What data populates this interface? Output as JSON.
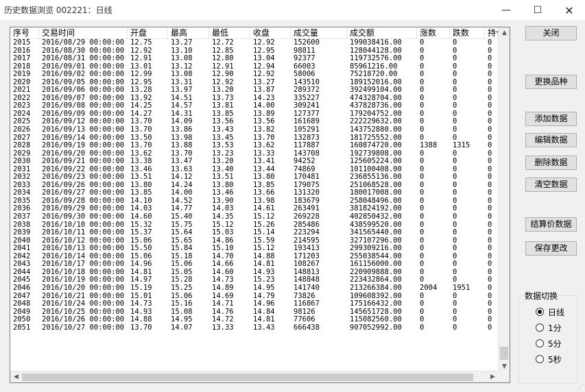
{
  "window": {
    "title": "历史数据浏览 002221：日线"
  },
  "columns": [
    "序号",
    "交易时间",
    "开盘",
    "最高",
    "最低",
    "收盘",
    "成交量",
    "成交额",
    "涨数",
    "跌数",
    "持仓"
  ],
  "rows": [
    [
      "2015",
      "2016/08/29 00:00:00",
      "12.75",
      "13.27",
      "12.72",
      "12.92",
      "152600",
      "199038416.00",
      "0",
      "0",
      "0"
    ],
    [
      "2016",
      "2016/08/30 00:00:00",
      "12.92",
      "13.10",
      "12.85",
      "12.95",
      "98811",
      "128044128.00",
      "0",
      "0",
      "0"
    ],
    [
      "2017",
      "2016/08/31 00:00:00",
      "12.91",
      "13.08",
      "12.80",
      "13.04",
      "92377",
      "119732576.00",
      "0",
      "0",
      "0"
    ],
    [
      "2018",
      "2016/09/01 00:00:00",
      "13.01",
      "13.12",
      "12.91",
      "12.94",
      "66003",
      "85961216.00",
      "0",
      "0",
      "0"
    ],
    [
      "2019",
      "2016/09/02 00:00:00",
      "12.99",
      "13.08",
      "12.90",
      "12.92",
      "58006",
      "75218720.00",
      "0",
      "0",
      "0"
    ],
    [
      "2020",
      "2016/09/05 00:00:00",
      "12.95",
      "13.31",
      "12.92",
      "13.27",
      "143510",
      "189152016.00",
      "0",
      "0",
      "0"
    ],
    [
      "2021",
      "2016/09/06 00:00:00",
      "13.28",
      "13.97",
      "13.20",
      "13.87",
      "289372",
      "392499104.00",
      "0",
      "0",
      "0"
    ],
    [
      "2022",
      "2016/09/07 00:00:00",
      "13.92",
      "14.51",
      "13.73",
      "14.23",
      "335227",
      "474328704.00",
      "0",
      "0",
      "0"
    ],
    [
      "2023",
      "2016/09/08 00:00:00",
      "14.25",
      "14.57",
      "13.81",
      "14.00",
      "309241",
      "437828736.00",
      "0",
      "0",
      "0"
    ],
    [
      "2024",
      "2016/09/09 00:00:00",
      "14.27",
      "14.31",
      "13.85",
      "13.89",
      "127377",
      "179204752.00",
      "0",
      "0",
      "0"
    ],
    [
      "2025",
      "2016/09/12 00:00:00",
      "13.70",
      "14.09",
      "13.56",
      "13.56",
      "161689",
      "222229632.00",
      "0",
      "0",
      "0"
    ],
    [
      "2026",
      "2016/09/13 00:00:00",
      "13.70",
      "13.86",
      "13.43",
      "13.82",
      "105291",
      "143752880.00",
      "0",
      "0",
      "0"
    ],
    [
      "2027",
      "2016/09/14 00:00:00",
      "13.50",
      "13.98",
      "13.45",
      "13.70",
      "132873",
      "181725552.00",
      "0",
      "0",
      "0"
    ],
    [
      "2028",
      "2016/09/19 00:00:00",
      "13.70",
      "13.88",
      "13.53",
      "13.62",
      "117887",
      "160874720.00",
      "1388",
      "1315",
      "0"
    ],
    [
      "2029",
      "2016/09/20 00:00:00",
      "13.62",
      "13.70",
      "13.23",
      "13.33",
      "143708",
      "192739808.00",
      "0",
      "0",
      "0"
    ],
    [
      "2030",
      "2016/09/21 00:00:00",
      "13.38",
      "13.47",
      "13.20",
      "13.41",
      "94252",
      "125605224.00",
      "0",
      "0",
      "0"
    ],
    [
      "2031",
      "2016/09/22 00:00:00",
      "13.46",
      "13.63",
      "13.40",
      "13.44",
      "74869",
      "101100408.00",
      "0",
      "0",
      "0"
    ],
    [
      "2032",
      "2016/09/23 00:00:00",
      "13.51",
      "14.12",
      "13.51",
      "13.80",
      "170481",
      "236855136.00",
      "0",
      "0",
      "0"
    ],
    [
      "2033",
      "2016/09/26 00:00:00",
      "13.80",
      "14.24",
      "13.80",
      "13.85",
      "179075",
      "251068528.00",
      "0",
      "0",
      "0"
    ],
    [
      "2034",
      "2016/09/27 00:00:00",
      "13.85",
      "14.00",
      "13.46",
      "13.66",
      "131320",
      "180017008.00",
      "0",
      "0",
      "0"
    ],
    [
      "2035",
      "2016/09/28 00:00:00",
      "14.10",
      "14.52",
      "13.90",
      "13.98",
      "183679",
      "258048496.00",
      "0",
      "0",
      "0"
    ],
    [
      "2036",
      "2016/09/29 00:00:00",
      "14.03",
      "14.77",
      "14.03",
      "14.61",
      "263491",
      "381824192.00",
      "0",
      "0",
      "0"
    ],
    [
      "2037",
      "2016/09/30 00:00:00",
      "14.60",
      "15.40",
      "14.35",
      "15.12",
      "269228",
      "402850432.00",
      "0",
      "0",
      "0"
    ],
    [
      "2038",
      "2016/10/10 00:00:00",
      "15.32",
      "15.75",
      "15.12",
      "15.26",
      "285486",
      "438599520.00",
      "0",
      "0",
      "0"
    ],
    [
      "2039",
      "2016/10/11 00:00:00",
      "15.37",
      "15.64",
      "15.03",
      "15.14",
      "223294",
      "341565440.00",
      "0",
      "0",
      "0"
    ],
    [
      "2040",
      "2016/10/12 00:00:00",
      "15.06",
      "15.65",
      "14.86",
      "15.59",
      "214595",
      "327107296.00",
      "0",
      "0",
      "0"
    ],
    [
      "2041",
      "2016/10/13 00:00:00",
      "15.50",
      "15.84",
      "15.10",
      "15.12",
      "193413",
      "299309216.00",
      "0",
      "0",
      "0"
    ],
    [
      "2042",
      "2016/10/14 00:00:00",
      "15.06",
      "15.18",
      "14.70",
      "14.88",
      "171203",
      "255038544.00",
      "0",
      "0",
      "0"
    ],
    [
      "2043",
      "2016/10/17 00:00:00",
      "14.96",
      "15.06",
      "14.66",
      "14.81",
      "108267",
      "161156000.00",
      "0",
      "0",
      "0"
    ],
    [
      "2044",
      "2016/10/18 00:00:00",
      "14.81",
      "15.05",
      "14.60",
      "14.93",
      "148813",
      "220909888.00",
      "0",
      "0",
      "0"
    ],
    [
      "2045",
      "2016/10/19 00:00:00",
      "14.97",
      "15.28",
      "14.73",
      "15.23",
      "148848",
      "223432864.00",
      "0",
      "0",
      "0"
    ],
    [
      "2046",
      "2016/10/20 00:00:00",
      "15.19",
      "15.25",
      "14.89",
      "14.95",
      "141740",
      "213266384.00",
      "2004",
      "1951",
      "0"
    ],
    [
      "2047",
      "2016/10/21 00:00:00",
      "15.01",
      "15.06",
      "14.69",
      "14.79",
      "73826",
      "109608392.00",
      "0",
      "0",
      "0"
    ],
    [
      "2048",
      "2016/10/24 00:00:00",
      "14.73",
      "15.16",
      "14.71",
      "14.96",
      "116867",
      "175166432.00",
      "0",
      "0",
      "0"
    ],
    [
      "2049",
      "2016/10/25 00:00:00",
      "14.93",
      "15.08",
      "14.76",
      "14.84",
      "98126",
      "145651728.00",
      "0",
      "0",
      "0"
    ],
    [
      "2050",
      "2016/10/26 00:00:00",
      "14.88",
      "14.95",
      "14.72",
      "14.81",
      "77606",
      "115082560.00",
      "0",
      "0",
      "0"
    ],
    [
      "2051",
      "2016/10/27 00:00:00",
      "13.70",
      "14.07",
      "13.33",
      "13.43",
      "666438",
      "907052992.00",
      "0",
      "0",
      "0"
    ]
  ],
  "buttons": {
    "close": "关闭",
    "change_symbol": "更换品种",
    "add_data": "添加数据",
    "edit_data": "编辑数据",
    "delete_data": "删除数据",
    "clear_data": "清空数据",
    "settlement_data": "结算价数据",
    "save_changes": "保存更改"
  },
  "data_switch": {
    "label": "数据切换",
    "options": [
      "日线",
      "1分",
      "5分",
      "5秒"
    ],
    "selected": "日线"
  }
}
